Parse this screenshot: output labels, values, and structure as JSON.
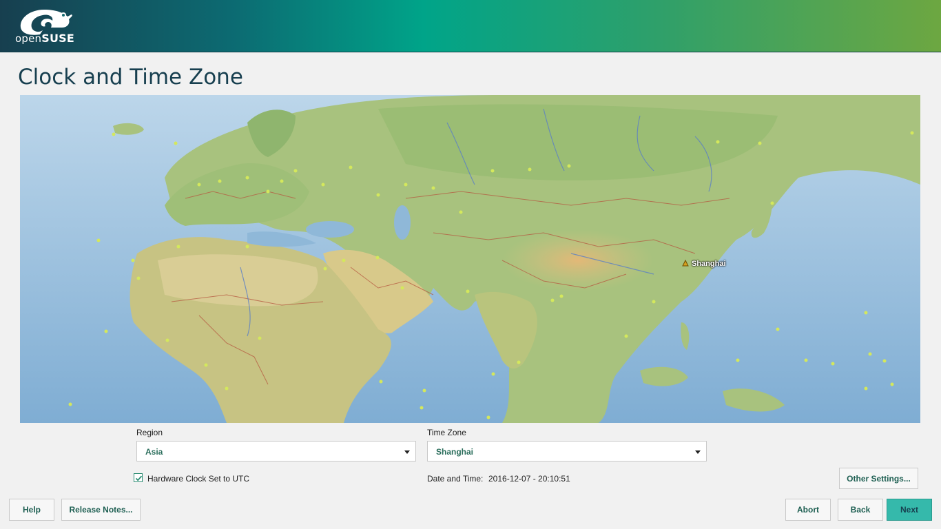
{
  "brand": {
    "logo_text_light": "open",
    "logo_text_bold": "SUSE"
  },
  "page": {
    "title": "Clock and Time Zone"
  },
  "map": {
    "selected_city": "Shanghai"
  },
  "region": {
    "label": "Region",
    "value": "Asia"
  },
  "timezone": {
    "label": "Time Zone",
    "value": "Shanghai"
  },
  "hardware_clock": {
    "label": "Hardware Clock Set to UTC",
    "checked": true
  },
  "datetime": {
    "label": "Date and Time:",
    "value": "2016-12-07 - 20:10:51"
  },
  "buttons": {
    "other_settings": "Other Settings...",
    "help": "Help",
    "release_notes": "Release Notes...",
    "abort": "Abort",
    "back": "Back",
    "next": "Next"
  },
  "colors": {
    "accent": "#35b9ab",
    "title": "#173f4f",
    "banner_start": "#173f4f",
    "banner_end": "#6da741"
  }
}
